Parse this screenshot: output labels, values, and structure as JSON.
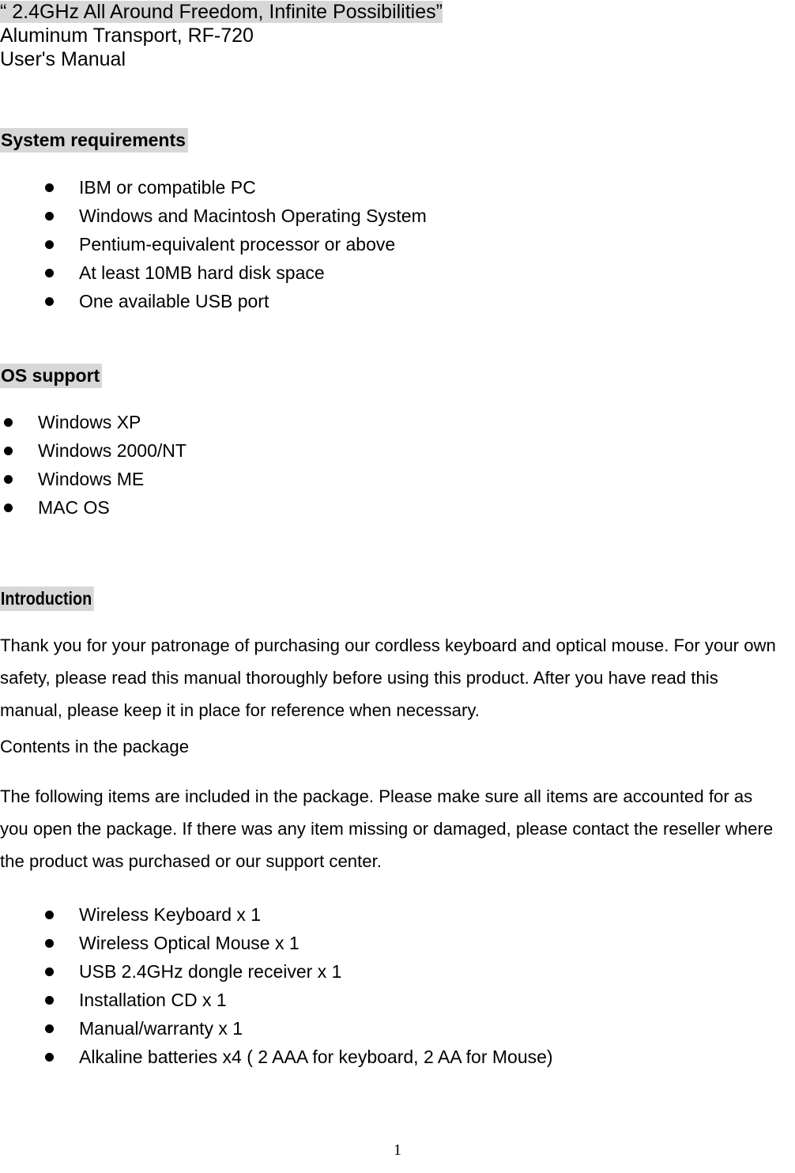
{
  "document": {
    "title_lines": [
      {
        "text": "“ 2.4GHz All Around Freedom, Infinite Possibilities”",
        "highlighted": true
      },
      {
        "text": "Aluminum Transport, RF-720",
        "highlighted": false
      },
      {
        "text": "User's Manual",
        "highlighted": false
      }
    ],
    "highlight_color": "#d7d7d7",
    "page_number": "1"
  },
  "sections": {
    "system_requirements": {
      "heading": "System requirements",
      "items": [
        "IBM or compatible PC",
        "Windows and Macintosh Operating System",
        "Pentium-equivalent processor or above",
        "At least 10MB hard disk space",
        "One available USB port"
      ]
    },
    "os_support": {
      "heading": "OS support",
      "items": [
        "Windows XP",
        "Windows 2000/NT",
        "Windows ME",
        "MAC OS"
      ]
    },
    "introduction": {
      "heading": "Introduction",
      "paragraph_1": "Thank you for your patronage of purchasing our cordless keyboard and optical mouse. For your own safety, please read this manual thoroughly before using this product. After you have read this manual, please keep it in place for reference when necessary.",
      "subheading": "Contents in the package",
      "paragraph_2": "The following items are included in the package. Please make sure all items are accounted for as you open the package. If there was any item missing or damaged, please contact the reseller where the product was purchased or our support center.",
      "package_items": [
        "Wireless Keyboard x 1",
        "Wireless Optical Mouse x 1",
        "USB 2.4GHz dongle receiver x 1",
        "Installation CD x 1",
        "Manual/warranty x 1",
        "Alkaline batteries x4 ( 2 AAA for keyboard, 2 AA for Mouse)"
      ]
    }
  }
}
